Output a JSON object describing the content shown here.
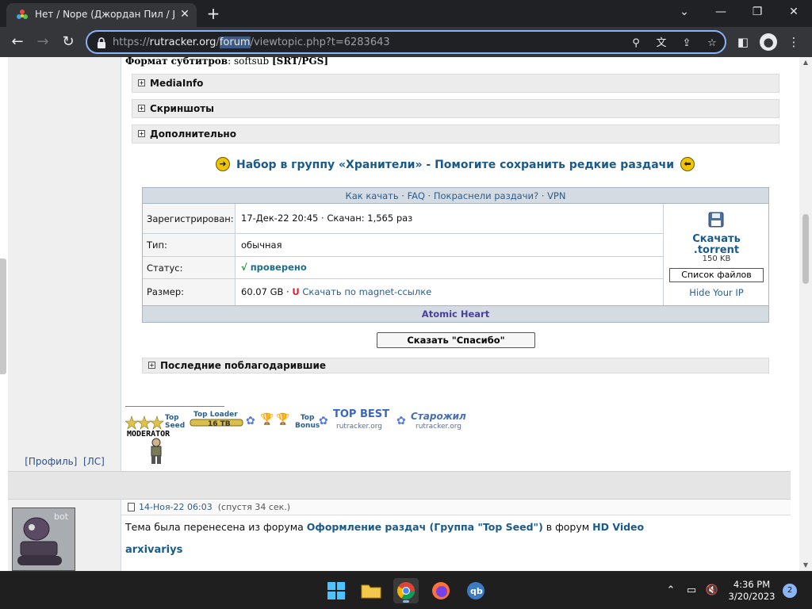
{
  "browser": {
    "tab_title": "Нет / Nope (Джордан Пил / Jordan Peele)",
    "url_scheme": "https://",
    "url_host": "rutracker.org",
    "url_slash": "/",
    "url_highlight": "forum",
    "url_rest": "/viewtopic.php?t=6283643"
  },
  "post": {
    "subtitle_label": "Формат субтитров",
    "subtitle_value": ": softsub ",
    "subtitle_format": "[SRT/PGS]",
    "spoilers": [
      "MediaInfo",
      "Скриншоты",
      "Дополнительно"
    ],
    "keepers_part1": "Набор в группу «Хранители»",
    "keepers_sep": " - ",
    "keepers_part2": "Помогите сохранить редкие раздачи"
  },
  "torrent": {
    "head_links": [
      "Как качать",
      "FAQ",
      "Покраснели раздачи?",
      "VPN"
    ],
    "head_sep": " · ",
    "registered_label": "Зарегистрирован:",
    "registered_value": "17-Дек-22 20:45",
    "downloaded_value": "Скачан: 1,565 раз",
    "dot": " · ",
    "type_label": "Тип:",
    "type_value": "обычная",
    "status_label": "Статус:",
    "status_check": "√",
    "status_value": "проверено",
    "size_label": "Размер:",
    "size_value": "60.07 GB",
    "magnet_label": "Скачать по magnet-ссылке",
    "download_line1": "Скачать",
    "download_line2": ".torrent",
    "download_size": "150 KB",
    "file_list": "Список файлов",
    "hide_ip": "Hide Your IP",
    "footer_title": "Atomic Heart",
    "thanks_button": "Сказать \"Спасибо\"",
    "last_thanked": "Последние поблагодарившие"
  },
  "signature": {
    "top_seed": "Top\nSeed",
    "top_loader": "Top Loader",
    "top_loader_size": "16 TB",
    "top_bonus": "Top\nBonus",
    "top_best": "TOP BEST",
    "top_best_site": "rutracker.org",
    "old_timer": "Старожил",
    "old_timer_site": "rutracker.org",
    "moderator": "MODERATOR"
  },
  "left_column": {
    "profile": "[Профиль]",
    "pm": "[ЛС]"
  },
  "next_post": {
    "date": "14-Ноя-22 06:03",
    "after": "(спустя 34 сек.)",
    "text_before": "Тема была перенесена из форума ",
    "from_forum": "Оформление раздач (Группа \"Top Seed\")",
    "text_middle": " в форум ",
    "to_forum": "HD Video",
    "author": "arxivariys",
    "avatar_tag": "bot"
  },
  "system": {
    "time": "4:36 PM",
    "date": "3/20/2023",
    "notification_count": "2"
  },
  "colors": {
    "link": "#1a5a8a",
    "header_bg": "#d5dbe3",
    "footer_title": "#4a3f9c",
    "omnibox_focus": "#8ab4f8"
  }
}
